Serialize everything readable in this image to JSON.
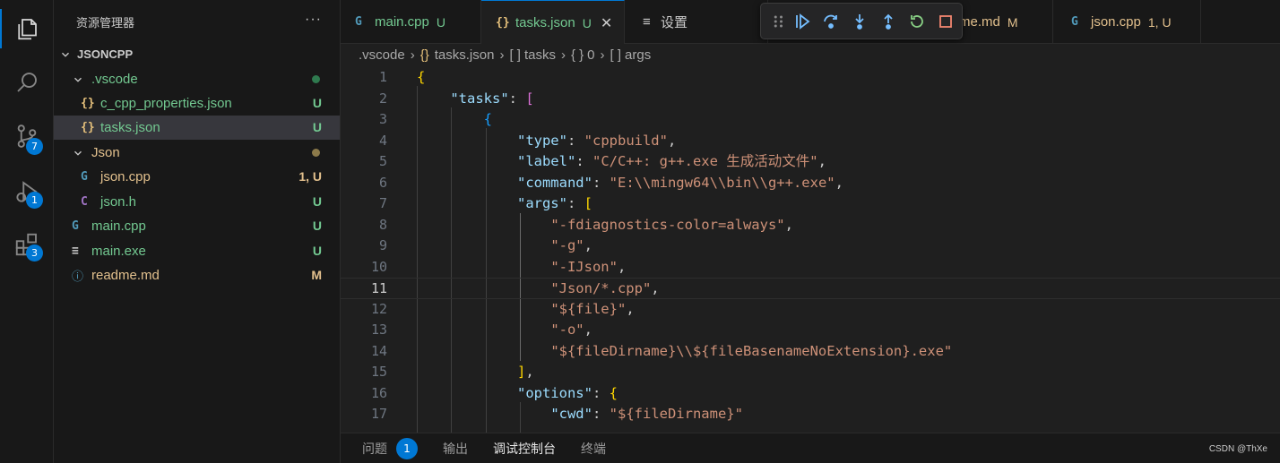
{
  "sidebar": {
    "title": "资源管理器",
    "more": "···",
    "root": "JSONCPP",
    "items": [
      {
        "label": ".vscode",
        "status": "",
        "color": "#73c991"
      },
      {
        "label": "c_cpp_properties.json",
        "icon": "{}",
        "status": "U",
        "color": "#73c991"
      },
      {
        "label": "tasks.json",
        "icon": "{}",
        "status": "U",
        "color": "#73c991"
      },
      {
        "label": "Json",
        "status": "",
        "color": "#e2c08d"
      },
      {
        "label": "json.cpp",
        "icon": "G",
        "status": "1, U",
        "color": "#e2c08d"
      },
      {
        "label": "json.h",
        "icon": "C",
        "status": "U",
        "color": "#73c991"
      },
      {
        "label": "main.cpp",
        "icon": "G",
        "status": "U",
        "color": "#73c991"
      },
      {
        "label": "main.exe",
        "icon": "≡",
        "status": "U",
        "color": "#73c991"
      },
      {
        "label": "readme.md",
        "icon": "ⓘ",
        "status": "M",
        "color": "#e2c08d"
      }
    ]
  },
  "activity": {
    "source_control_badge": "7",
    "debug_badge": "1",
    "extensions_badge": "3"
  },
  "tabs": [
    {
      "label": "main.cpp",
      "status": "U",
      "color": "#73c991"
    },
    {
      "label": "tasks.json",
      "status": "U",
      "color": "#73c991",
      "close": "✕"
    },
    {
      "label": "设置",
      "status": ""
    },
    {
      "label": "me.md",
      "status": "M",
      "color": "#e2c08d"
    },
    {
      "label": "json.cpp",
      "status": "1, U",
      "color": "#e2c08d"
    }
  ],
  "breadcrumb": [
    ".vscode",
    "tasks.json",
    "tasks",
    "0",
    "args"
  ],
  "editor": {
    "line_numbers": [
      "1",
      "2",
      "3",
      "4",
      "5",
      "6",
      "7",
      "8",
      "9",
      "10",
      "11",
      "12",
      "13",
      "14",
      "15",
      "16",
      "17"
    ],
    "current_line": "11",
    "values": {
      "tasks_key": "\"tasks\"",
      "type_key": "\"type\"",
      "type_val": "\"cppbuild\"",
      "label_key": "\"label\"",
      "label_val": "\"C/C++: g++.exe 生成活动文件\"",
      "command_key": "\"command\"",
      "command_val": "\"E:\\\\mingw64\\\\bin\\\\g++.exe\"",
      "args_key": "\"args\"",
      "arg1": "\"-fdiagnostics-color=always\"",
      "arg2": "\"-g\"",
      "arg3": "\"-IJson\"",
      "arg4": "\"Json/*.cpp\"",
      "arg5": "\"${file}\"",
      "arg6": "\"-o\"",
      "arg7": "\"${fileDirname}\\\\${fileBasenameNoExtension}.exe\"",
      "options_key": "\"options\"",
      "cwd_key": "\"cwd\"",
      "cwd_val": "\"${fileDirname}\""
    }
  },
  "panel": {
    "tabs": [
      "问题",
      "输出",
      "调试控制台",
      "终端"
    ],
    "problems_badge": "1",
    "watermark": "CSDN @ThXe"
  },
  "colors": {
    "accent": "#0078d4",
    "untracked": "#73c991",
    "modified": "#e2c08d",
    "debug_blue": "#75beff",
    "debug_green": "#89d185",
    "debug_red": "#f48771"
  }
}
